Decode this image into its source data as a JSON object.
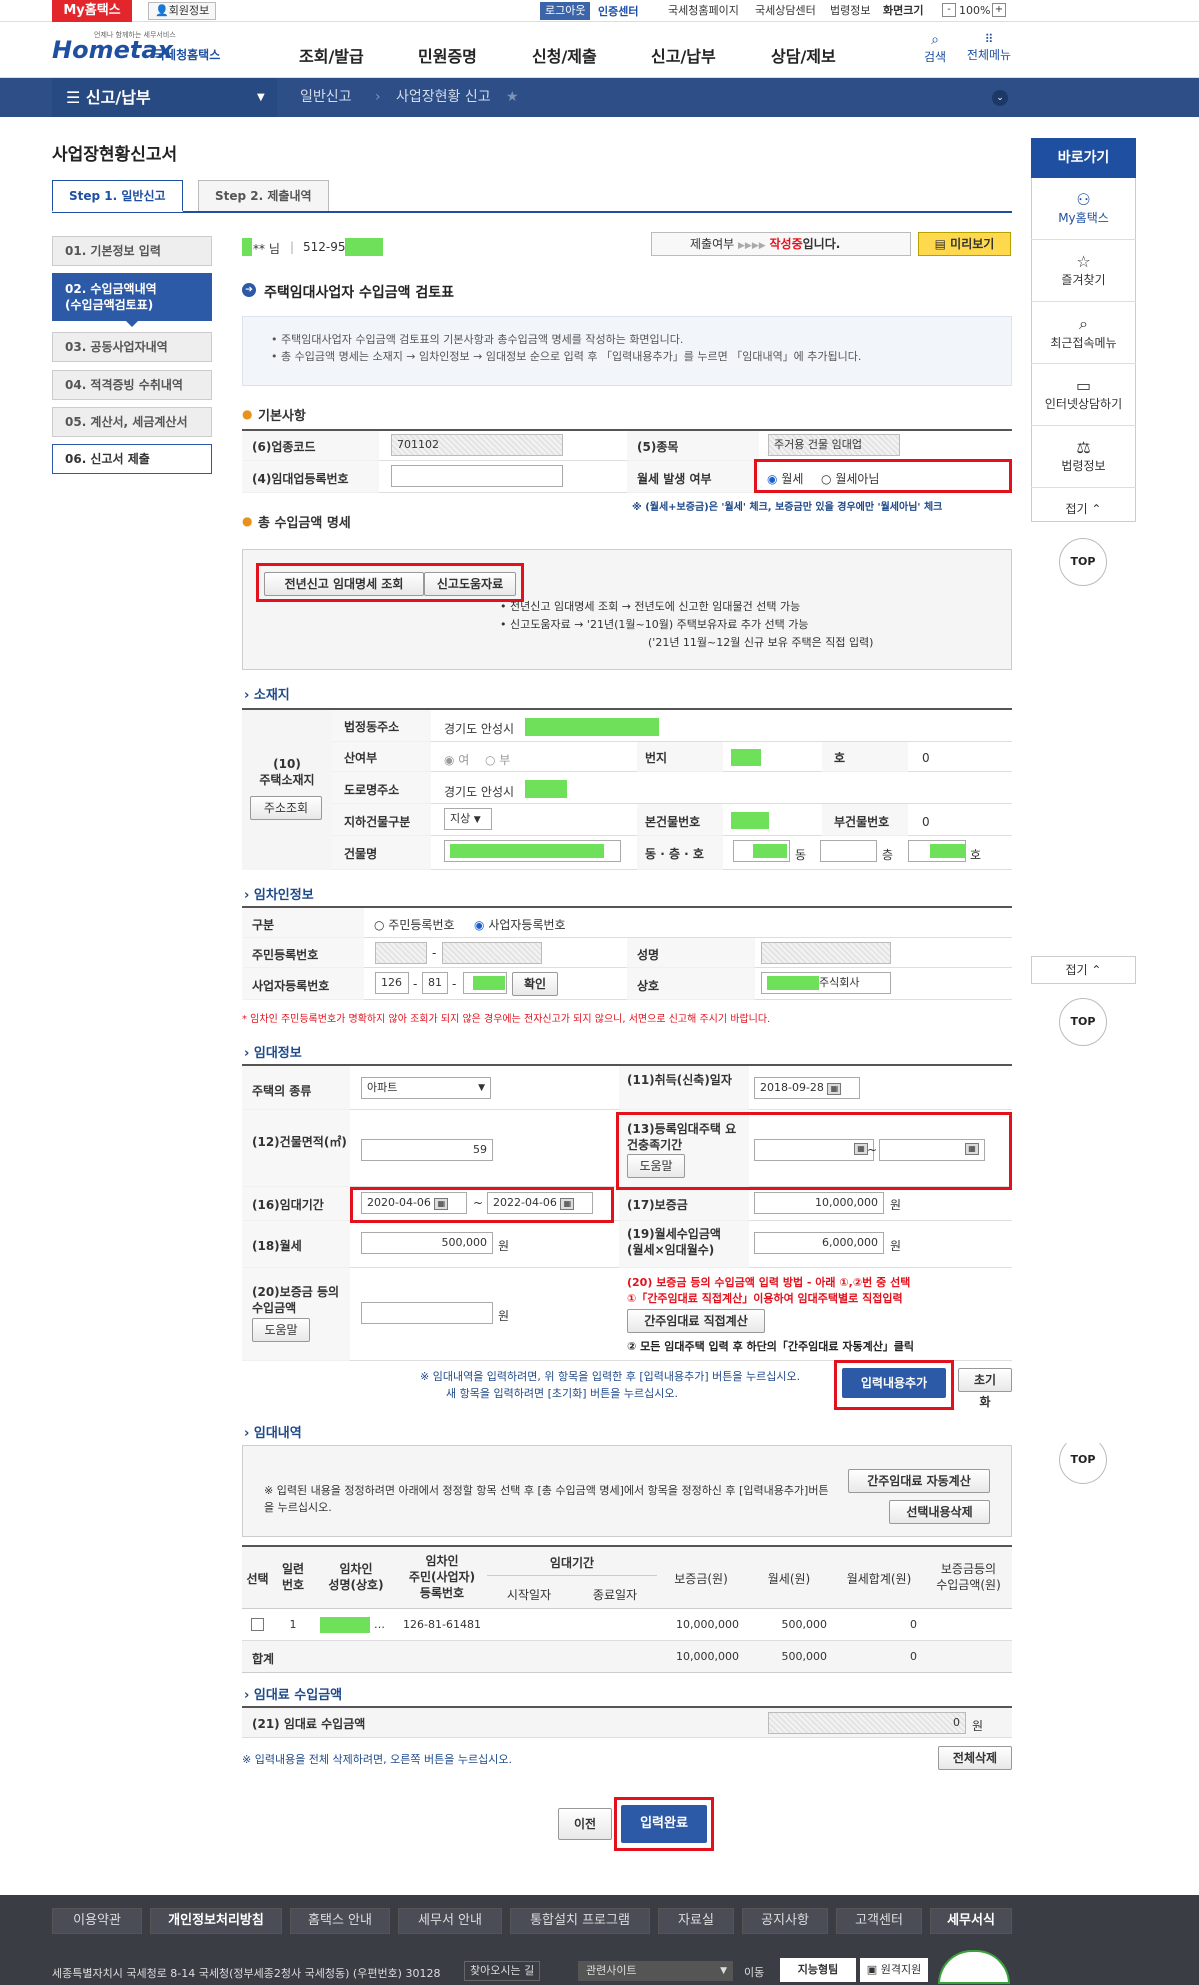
{
  "util": {
    "myhome": "My홈택스",
    "member_info": "회원정보",
    "logout": "로그아웃",
    "cert_center": "인증센터",
    "links": [
      "국세청홈페이지",
      "국세상담센터",
      "법령정보"
    ],
    "screen_size": "화면크기",
    "zoom": "100%",
    "zoom_minus": "-",
    "zoom_plus": "+"
  },
  "header": {
    "logo_main": "Hometax",
    "logo_sub": "국세청홈택스",
    "logo_tag": "언제나 함께하는 세무서비스",
    "gnb": [
      "조회/발급",
      "민원증명",
      "신청/제출",
      "신고/납부",
      "상담/제보"
    ],
    "search": "검색",
    "all_menu": "전체메뉴"
  },
  "nav": {
    "menu": "신고/납부",
    "crumbs": [
      "일반신고",
      "사업장현황 신고"
    ]
  },
  "page": {
    "title": "사업장현황신고서",
    "tabs": [
      "Step 1. 일반신고",
      "Step 2. 제출내역"
    ]
  },
  "left_menu": [
    "01. 기본정보 입력",
    "02. 수입금액내역\n(수입금액검토표)",
    "03. 공동사업자내역",
    "04. 적격증빙 수취내역",
    "05. 계산서, 세금계산서",
    "06. 신고서 제출"
  ],
  "user": {
    "name_suffix": "** 님",
    "biz_no": "512-95-",
    "submit_label": "제출여부",
    "submit_arrows": "▶▶▶▶",
    "submit_status": "작성중",
    "submit_tail": "입니다.",
    "preview": "미리보기"
  },
  "review": {
    "title": "주택임대사업자 수입금액 검토표",
    "info": [
      "주택임대사업자 수입금액 검토표의 기본사항과 총수입금액 명세를 작성하는 화면입니다.",
      "총 수입금액 명세는 소재지 → 임차인정보 → 임대정보 순으로 입력 후 「입력내용추가」를 누르면 「임대내역」에 추가됩니다."
    ]
  },
  "basic": {
    "section": "기본사항",
    "industry_code_label": "(6)업종코드",
    "industry_code": "701102",
    "type_label": "(5)종목",
    "type_value": "주거용 건물 임대업",
    "reg_no_label": "(4)임대업등록번호",
    "rent_label": "월세 발생 여부",
    "rent_yes": "월세",
    "rent_no": "월세아님",
    "rent_note": "※ (월세+보증금)은 '월세' 체크, 보증금만 있을 경우에만 '월세아님' 체크"
  },
  "total": {
    "section": "총 수입금액 명세",
    "btn_prev": "전년신고 임대명세 조회",
    "btn_help": "신고도움자료",
    "notes": [
      "전년신고 임대명세 조회 → 전년도에 신고한 임대물건 선택 가능",
      "신고도움자료 → '21년(1월~10월) 주택보유자료 추가 선택 가능",
      "('21년 11월~12월 신규 보유 주택은 직접 입력)"
    ]
  },
  "location": {
    "section": "소재지",
    "side_label": "(10)\n주택소재지",
    "addr_search": "주소조회",
    "legal_addr_label": "법정동주소",
    "legal_addr": "경기도 안성시",
    "mountain_label": "산여부",
    "yes": "여",
    "no": "부",
    "lot_label": "번지",
    "ho_label": "호",
    "ho_value": "0",
    "road_label": "도로명주소",
    "road_addr": "경기도 안성시",
    "underground_label": "지하건물구분",
    "underground_value": "지상",
    "main_bldg_label": "본건물번호",
    "sub_bldg_label": "부건물번호",
    "sub_bldg_value": "0",
    "bldg_name_label": "건물명",
    "dong_label": "동 · 층 · 호",
    "dong": "동",
    "floor": "층",
    "ho": "호"
  },
  "tenant": {
    "section": "임차인정보",
    "kind_label": "구분",
    "opt_resident": "주민등록번호",
    "opt_biz": "사업자등록번호",
    "resident_label": "주민등록번호",
    "name_label": "성명",
    "biz_label": "사업자등록번호",
    "biz1": "126",
    "biz2": "81",
    "confirm": "확인",
    "company_label": "상호",
    "company_suffix": "주식회사",
    "warning": "* 임차인 주민등록번호가 명확하지 않아 조회가 되지 않은 경우에는 전자신고가 되지 않으니, 서면으로 신고해 주시기 바랍니다."
  },
  "rental": {
    "section": "임대정보",
    "house_type_label": "주택의 종류",
    "house_type": "아파트",
    "acq_label": "(11)취득(신축)일자",
    "acq_date": "2018-09-28",
    "area_label": "(12)건물면적(㎡)",
    "area": "59",
    "reg_period_label": "(13)등록임대주택 요건충족기간",
    "help": "도움말",
    "period_label": "(16)임대기간",
    "period_from": "2020-04-06",
    "period_to": "2022-04-06",
    "deposit_label": "(17)보증금",
    "deposit": "10,000,000",
    "won": "원",
    "monthly_label": "(18)월세",
    "monthly": "500,000",
    "monthly_income_label": "(19)월세수입금액\n(월세×임대월수)",
    "monthly_income": "6,000,000",
    "dep_income_label": "(20)보증금 등의 수입금액",
    "dep_note1": "(20) 보증금 등의 수입금액 입력 방법 - 아래 ①,②번 중 선택",
    "dep_note2": "①「간주임대료 직접계산」이용하여 임대주택별로 직접입력",
    "dep_direct": "간주임대료 직접계산",
    "dep_note3": "② 모든 임대주택 입력 후 하단의「간주임대료 자동계산」클릭",
    "add_note1": "※ 임대내역을 입력하려면, 위 항목을 입력한 후 [입력내용추가] 버튼을 누르십시오.",
    "add_note2": "새 항목을 입력하려면 [초기화] 버튼을 누르십시오.",
    "add_btn": "입력내용추가",
    "reset_btn": "초기화"
  },
  "history": {
    "section": "임대내역",
    "note": "※ 입력된 내용을 정정하려면 아래에서 정정할 항목 선택 후 [총 수입금액 명세]에서 항목을 정정하신 후 [입력내용추가]버튼을 누르십시오.",
    "auto_calc": "간주임대료 자동계산",
    "delete_sel": "선택내용삭제",
    "cols": [
      "선택",
      "일련\n번호",
      "임차인\n성명(상호)",
      "임차인\n주민(사업자)\n등록번호",
      "임대기간",
      "보증금(원)",
      "월세(원)",
      "월세합계(원)",
      "보증금등의\n수입금액(원)"
    ],
    "sub_cols": [
      "시작일자",
      "종료일자"
    ],
    "row": {
      "no": "1",
      "name_tail": "…",
      "reg": "126-81-61481",
      "deposit": "10,000,000",
      "monthly": "500,000",
      "sum": "0"
    },
    "total_label": "합계",
    "total_deposit": "10,000,000",
    "total_monthly": "500,000",
    "total_sum": "0"
  },
  "income": {
    "section": "임대료 수입금액",
    "label": "(21) 임대료 수입금액",
    "value": "0",
    "won": "원",
    "del_note": "※ 입력내용을 전체 삭제하려면, 오른쪽 버튼을 누르십시오.",
    "del_all": "전체삭제"
  },
  "actions": {
    "prev": "이전",
    "complete": "입력완료"
  },
  "quick": {
    "title": "바로가기",
    "items": [
      "My홈택스",
      "즐겨찾기",
      "최근접속메뉴",
      "인터넷상담하기",
      "법령정보"
    ],
    "fold": "접기",
    "top": "TOP"
  },
  "footer": {
    "links": [
      "이용약관",
      "개인정보처리방침",
      "홈택스 안내",
      "세무서 안내",
      "통합설치 프로그램",
      "자료실",
      "공지사항",
      "고객센터",
      "세무서식"
    ],
    "address": "세종특별자치시 국세청로 8-14 국세청(정부세종2청사 국세청동) (우편번호) 30128",
    "find_way": "찾아오시는 길",
    "related": "관련사이트",
    "go": "이동",
    "badge1": "지능형팀",
    "badge2": "원격지원"
  }
}
